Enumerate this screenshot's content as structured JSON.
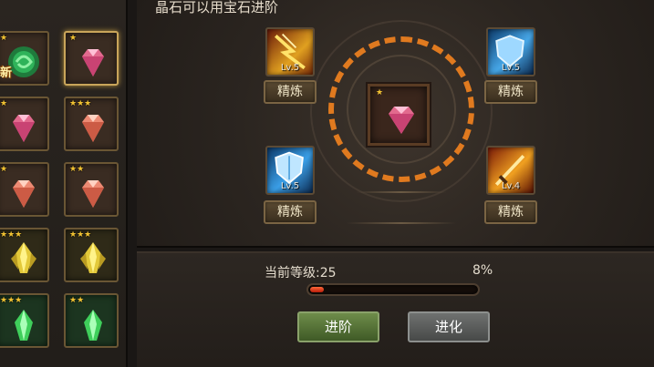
{
  "header": {
    "hint": "晶石可以用宝石进阶"
  },
  "inventory": [
    {
      "stars": "★",
      "tag": "新",
      "gem": "green-swirl",
      "selected": false
    },
    {
      "stars": "★",
      "tag": "",
      "gem": "pink-diamond",
      "selected": true
    },
    {
      "stars": "★",
      "tag": "",
      "gem": "pink-diamond",
      "selected": false
    },
    {
      "stars": "★★★",
      "tag": "",
      "gem": "salmon-diamond",
      "selected": false
    },
    {
      "stars": "★",
      "tag": "",
      "gem": "salmon-diamond",
      "selected": false
    },
    {
      "stars": "★★",
      "tag": "",
      "gem": "salmon-diamond",
      "selected": false
    },
    {
      "stars": "★★★",
      "tag": "",
      "gem": "gold-crystal",
      "selected": false
    },
    {
      "stars": "★★★",
      "tag": "",
      "gem": "gold-crystal",
      "selected": false
    },
    {
      "stars": "★★★",
      "tag": "",
      "gem": "green-crystal",
      "selected": false
    },
    {
      "stars": "★★",
      "tag": "",
      "gem": "green-crystal",
      "selected": false
    }
  ],
  "center": {
    "stars": "★",
    "gem": "pink-diamond"
  },
  "skills": [
    {
      "lv": "Lv.5",
      "icon": "lightning-claw-icon",
      "button": "精炼"
    },
    {
      "lv": "Lv.5",
      "icon": "ice-shield-icon",
      "button": "精炼"
    },
    {
      "lv": "Lv.5",
      "icon": "frost-shield-icon",
      "button": "精炼"
    },
    {
      "lv": "Lv.4",
      "icon": "flame-sword-icon",
      "button": "精炼"
    }
  ],
  "progress": {
    "level_text": "当前等级:25",
    "percent_text": "8%",
    "percent": 0.08
  },
  "buttons": {
    "advance": "进阶",
    "evolve": "进化"
  },
  "colors": {
    "ring": "#e07a1f",
    "bar": "#d0361a",
    "accent": "#c9a55a"
  }
}
